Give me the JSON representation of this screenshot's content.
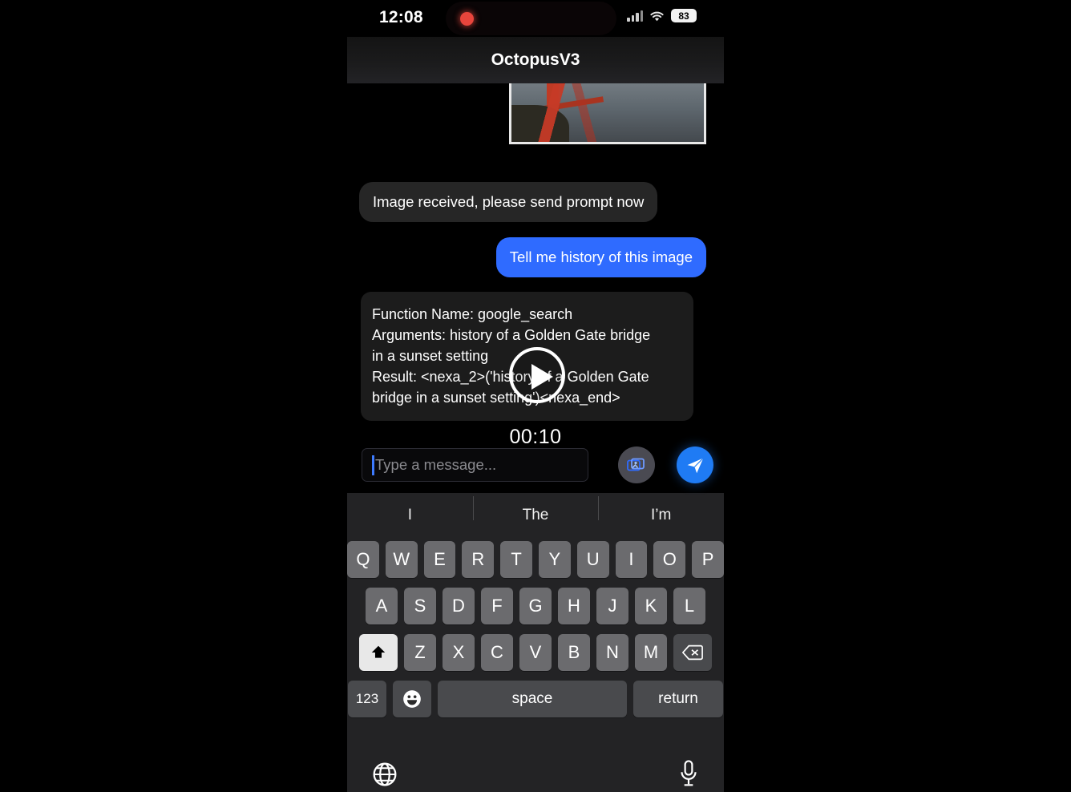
{
  "status_bar": {
    "time": "12:08",
    "battery": "83",
    "icons": [
      "record-dot-icon",
      "cellular-signal-icon",
      "wifi-icon",
      "battery-icon"
    ]
  },
  "header": {
    "title": "OctopusV3"
  },
  "chat": {
    "attachment": {
      "alt": "golden-gate-bridge-photo"
    },
    "messages": [
      {
        "id": "received",
        "side": "incoming",
        "text": "Image received, please send prompt now"
      },
      {
        "id": "prompt",
        "side": "outgoing",
        "text": "Tell me history of this image"
      }
    ],
    "function_call": {
      "line1": "Function Name: google_search",
      "line2": "Arguments: history of a Golden Gate bridge",
      "line3": "in a sunset setting",
      "line4": "Result:  <nexa_2>('history of a Golden Gate",
      "line5": "bridge in a sunset setting')<nexa_end>"
    }
  },
  "video_overlay": {
    "timer": "00:10",
    "play_label": "play-button"
  },
  "composer": {
    "input_value": "",
    "placeholder": "Type a message...",
    "photo_button": "photo-library-icon",
    "send_button": "send-icon",
    "accent_color": "#1f7bf4"
  },
  "keyboard": {
    "predictions": [
      "I",
      "The",
      "I’m"
    ],
    "row1": [
      "Q",
      "W",
      "E",
      "R",
      "T",
      "Y",
      "U",
      "I",
      "O",
      "P"
    ],
    "row2": [
      "A",
      "S",
      "D",
      "F",
      "G",
      "H",
      "J",
      "K",
      "L"
    ],
    "row3": [
      "Z",
      "X",
      "C",
      "V",
      "B",
      "N",
      "M"
    ],
    "shift_key": "shift-icon",
    "backspace_key": "backspace-icon",
    "numbers_key": "123",
    "emoji_key": "emoji-icon",
    "space_key": "space",
    "return_key": "return",
    "globe_key": "globe-icon",
    "dictation_key": "microphone-icon"
  }
}
